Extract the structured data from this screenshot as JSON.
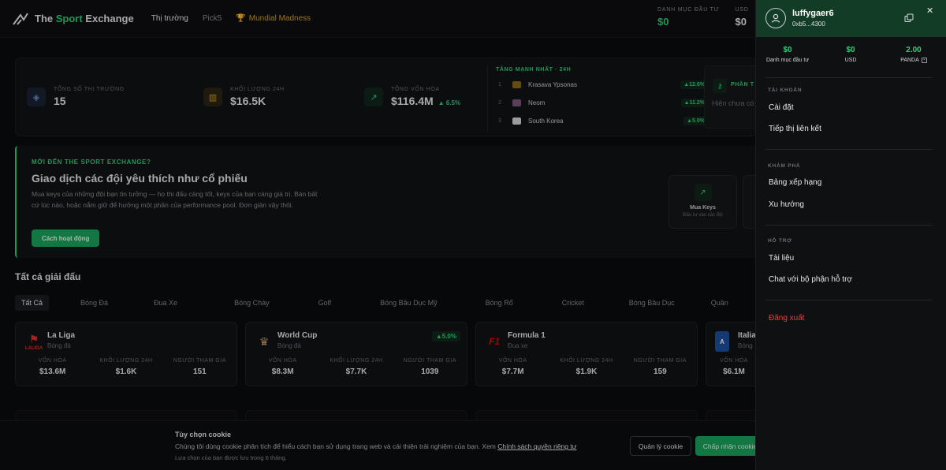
{
  "nav": {
    "brand_pre": "The ",
    "brand_green": "Sport",
    "brand_post": " Exchange",
    "links": [
      "Thị trường",
      "Pick5",
      "Mundial Madness"
    ]
  },
  "topstats": {
    "portfolio_label": "DANH MỤC ĐẦU TƯ",
    "portfolio_value": "$0",
    "usd_label": "USD",
    "usd_value": "$0"
  },
  "stats": {
    "markets_label": "TỔNG SỐ THỊ TRƯỜNG",
    "markets_value": "15",
    "volume_label": "KHỐI LƯỢNG 24H",
    "volume_value": "$16.5K",
    "mcap_label": "TỔNG VỐN HÓA",
    "mcap_value": "$116.4M",
    "mcap_change": "▲ 6.5%"
  },
  "gainers": {
    "title": "TĂNG MẠNH NHẤT · 24H",
    "rows": [
      {
        "rank": "1",
        "name": "Krasava Ypsonas",
        "change": "▲12.6%"
      },
      {
        "rank": "2",
        "name": "Neom",
        "change": "▲11.2%"
      },
      {
        "rank": "3",
        "name": "South Korea",
        "change": "▲5.0%"
      }
    ]
  },
  "side_card": {
    "title": "PHẦN T",
    "text": "Hiện chưa có thưởng."
  },
  "hero": {
    "kicker": "MỚI ĐẾN THE SPORT EXCHANGE?",
    "title": "Giao dịch các đội yêu thích như cổ phiếu",
    "desc": "Mua keys của những đội bạn tin tưởng — họ thi đấu càng tốt, keys của bạn càng giá trị. Bán bất cứ lúc nào, hoặc nắm giữ để hưởng một phần của performance pool. Đơn giản vậy thôi.",
    "button": "Cách hoạt động",
    "card_title": "Mua Keys",
    "card_sub": "Đầu tư vào các đội"
  },
  "tournaments": {
    "title": "Tất cả giải đấu",
    "filters": [
      "Tất Cả",
      "Bóng Đá",
      "Đua Xe",
      "Bóng Chày",
      "Golf",
      "Bóng Bầu Dục Mỹ",
      "Bóng Rổ",
      "Cricket",
      "Bóng Bầu Dục",
      "Quần"
    ],
    "col_labels": [
      "VỐN HÓA",
      "KHỐI LƯỢNG 24H",
      "NGƯỜI THAM GIA"
    ],
    "cards": [
      {
        "name": "La Liga",
        "sport": "Bóng đá",
        "logo": "LALIGA",
        "badge": "",
        "values": [
          "$13.6M",
          "$1.6K",
          "151"
        ]
      },
      {
        "name": "World Cup",
        "sport": "Bóng đá",
        "logo": "",
        "badge": "▲5.0%",
        "values": [
          "$8.3M",
          "$7.7K",
          "1039"
        ]
      },
      {
        "name": "Formula 1",
        "sport": "Đua xe",
        "logo": "F1",
        "badge": "",
        "values": [
          "$7.7M",
          "$1.9K",
          "159"
        ]
      },
      {
        "name": "Italia",
        "sport": "Bóng",
        "logo": "",
        "badge": "",
        "values": [
          "$6.1M"
        ]
      }
    ]
  },
  "cookie": {
    "title": "Tùy chọn cookie",
    "text": "Chúng tôi dùng cookie phân tích để hiểu cách bạn sử dụng trang web và cải thiện trải nghiệm của bạn. Xem ",
    "link": "Chính sách quyền riêng tư",
    "sub": "Lựa chọn của bạn được lưu trong 6 tháng.",
    "manage": "Quản lý cookie",
    "accept": "Chấp nhận cookie"
  },
  "drawer": {
    "username": "luffygaer6",
    "address": "0xb5...4300",
    "balances": [
      {
        "value": "$0",
        "label": "Danh mục đầu tư"
      },
      {
        "value": "$0",
        "label": "USD"
      },
      {
        "value": "2.00",
        "label": "PANDA"
      }
    ],
    "account_label": "TÀI KHOẢN",
    "account_items": [
      "Cài đặt",
      "Tiếp thị liên kết"
    ],
    "explore_label": "KHÁM PHÁ",
    "explore_items": [
      "Bảng xếp hạng",
      "Xu hướng"
    ],
    "support_label": "HỖ TRỢ",
    "support_items": [
      "Tài liệu",
      "Chat với bộ phận hỗ trợ"
    ],
    "logout": "Đăng xuất"
  },
  "colors": {
    "accent": "#2fd07a",
    "button": "#1ba55e",
    "gold": "#d6a32a",
    "danger": "#e54040",
    "drawer_head": "#133c27"
  }
}
